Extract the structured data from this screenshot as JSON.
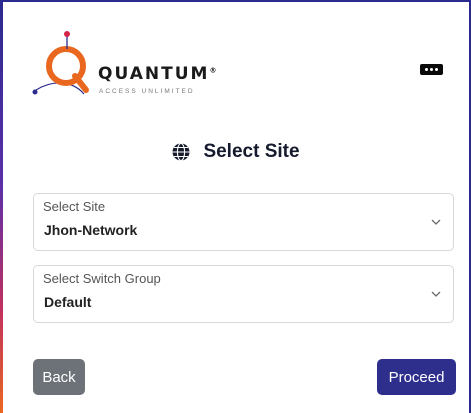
{
  "brand": {
    "name": "QUANTUM",
    "registered_mark": "®",
    "tagline": "ACCESS UNLIMITED",
    "colors": {
      "ring": "#e9671f",
      "accent_dot": "#d3244a",
      "accent_dot2": "#2b2a8f"
    }
  },
  "header": {
    "menu_icon": "more-horizontal-icon"
  },
  "page": {
    "title_icon": "globe-icon",
    "title": "Select Site"
  },
  "form": {
    "site": {
      "label": "Select Site",
      "value": "Jhon-Network"
    },
    "switch_group": {
      "label": "Select Switch Group",
      "value": "Default"
    }
  },
  "actions": {
    "back_label": "Back",
    "proceed_label": "Proceed",
    "colors": {
      "back": "#6d7278",
      "proceed": "#2e2e8d"
    }
  }
}
